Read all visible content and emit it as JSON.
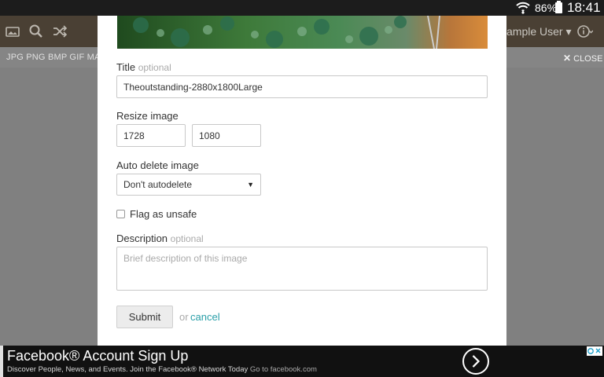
{
  "status_bar": {
    "battery_percent": "86%",
    "time": "18:41",
    "icons": [
      "wifi-icon",
      "battery-icon"
    ]
  },
  "app_bar": {
    "user_menu": "ample User ▾",
    "icons": [
      "image-icon",
      "search-icon",
      "shuffle-icon",
      "info-icon"
    ]
  },
  "sub_bar": {
    "formats": "JPG PNG BMP GIF   MAX",
    "close_label": "CLOSE"
  },
  "form": {
    "title": {
      "label": "Title",
      "optional": "optional",
      "value": "Theoutstanding-2880x1800Large"
    },
    "resize": {
      "label": "Resize image",
      "width": "1728",
      "height": "1080"
    },
    "auto_delete": {
      "label": "Auto delete image",
      "selected": "Don't autodelete"
    },
    "flag": {
      "label": "Flag as unsafe",
      "checked": false
    },
    "description": {
      "label": "Description",
      "optional": "optional",
      "placeholder": "Brief description of this image"
    },
    "submit_label": "Submit",
    "or_text": "or",
    "cancel_label": "cancel"
  },
  "ad": {
    "title": "Facebook® Account Sign Up",
    "description": "Discover People, News, and Events. Join the Facebook® Network Today",
    "link_text": "Go to facebook.com"
  },
  "colors": {
    "accent": "#2a9fa8",
    "app_bar": "#4a4034",
    "overlay": "#808080"
  }
}
